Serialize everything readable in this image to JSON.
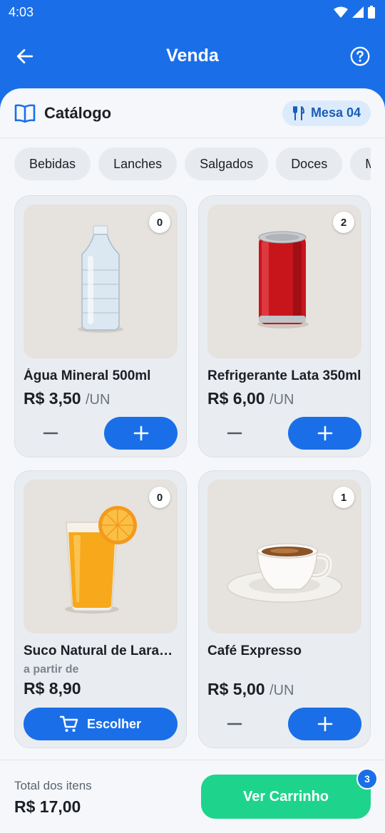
{
  "status_bar": {
    "time": "4:03"
  },
  "app_bar": {
    "title": "Venda",
    "back_icon": "arrow-left-icon",
    "help_icon": "help-circle-icon"
  },
  "catalog": {
    "title": "Catálogo",
    "icon": "book-icon",
    "table_badge": "Mesa 04",
    "table_icon": "utensils-icon"
  },
  "categories": [
    "Bebidas",
    "Lanches",
    "Salgados",
    "Doces",
    "M"
  ],
  "products": [
    {
      "name": "Água Mineral 500ml",
      "price": "R$ 3,50",
      "unit": "/UN",
      "qty": "0",
      "image": "water-bottle"
    },
    {
      "name": "Refrigerante Lata 350ml",
      "price": "R$ 6,00",
      "unit": "/UN",
      "qty": "2",
      "image": "soda-can"
    },
    {
      "name": "Suco Natural de Laranja",
      "from_label": "a partir de",
      "price": "R$ 8,90",
      "qty": "0",
      "choose_label": "Escolher",
      "image": "orange-juice"
    },
    {
      "name": "Café Expresso",
      "price": "R$ 5,00",
      "unit": "/UN",
      "qty": "1",
      "image": "espresso-cup"
    }
  ],
  "footer": {
    "total_label": "Total dos itens",
    "total_value": "R$ 17,00",
    "cart_button": "Ver Carrinho",
    "cart_count": "3"
  },
  "colors": {
    "primary": "#1a6fe8",
    "accent_green": "#1ed48c",
    "background": "#f5f7fa"
  }
}
